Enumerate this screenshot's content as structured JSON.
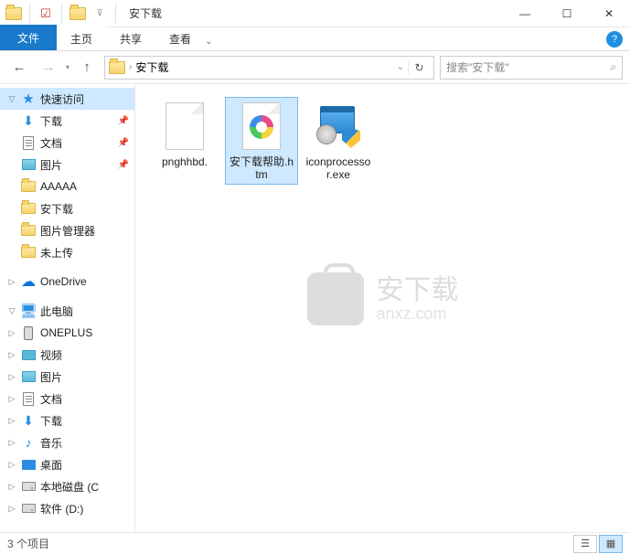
{
  "window": {
    "title": "安下载",
    "quick_icons": [
      "folder",
      "check-red",
      "check-blue"
    ]
  },
  "win_controls": {
    "min": "—",
    "max": "☐",
    "close": "✕"
  },
  "ribbon": {
    "file": "文件",
    "tabs": [
      "主页",
      "共享",
      "查看"
    ],
    "help_glyph": "?",
    "expand_glyph": "⌄"
  },
  "nav": {
    "back": "←",
    "fwd": "→",
    "dd": "▾",
    "up": "↑",
    "path_root_glyph": "›",
    "path_seg": "安下载",
    "addr_dd": "⌄",
    "refresh": "↻"
  },
  "search": {
    "placeholder": "搜索\"安下载\"",
    "icon": "⌕"
  },
  "sidebar": {
    "quick": "快速访问",
    "items_pinned": [
      {
        "label": "下载",
        "icon": "dl"
      },
      {
        "label": "文档",
        "icon": "doc"
      },
      {
        "label": "图片",
        "icon": "pic"
      }
    ],
    "items_recent": [
      {
        "label": "AAAAA",
        "icon": "folder"
      },
      {
        "label": "安下载",
        "icon": "folder"
      },
      {
        "label": "图片管理器",
        "icon": "folder"
      },
      {
        "label": "未上传",
        "icon": "folder"
      }
    ],
    "onedrive": "OneDrive",
    "thispc": "此电脑",
    "pc_items": [
      {
        "label": "ONEPLUS",
        "icon": "phone"
      },
      {
        "label": "视频",
        "icon": "vid"
      },
      {
        "label": "图片",
        "icon": "pic"
      },
      {
        "label": "文档",
        "icon": "doc"
      },
      {
        "label": "下载",
        "icon": "dl"
      },
      {
        "label": "音乐",
        "icon": "music"
      },
      {
        "label": "桌面",
        "icon": "desk"
      },
      {
        "label": "本地磁盘 (C",
        "icon": "drive"
      },
      {
        "label": "软件 (D:)",
        "icon": "drive"
      }
    ]
  },
  "files": [
    {
      "name": "pnghhbd.",
      "type": "blank"
    },
    {
      "name": "安下载帮助.htm",
      "type": "htm",
      "selected": true
    },
    {
      "name": "iconprocessor.exe",
      "type": "exe"
    }
  ],
  "status": {
    "text": "3 个项目"
  },
  "watermark": {
    "main": "安下载",
    "sub": "anxz.com"
  },
  "glyphs": {
    "pin": "📌",
    "chev_r": "›",
    "tri_closed": "▷",
    "tri_open": "▽"
  }
}
